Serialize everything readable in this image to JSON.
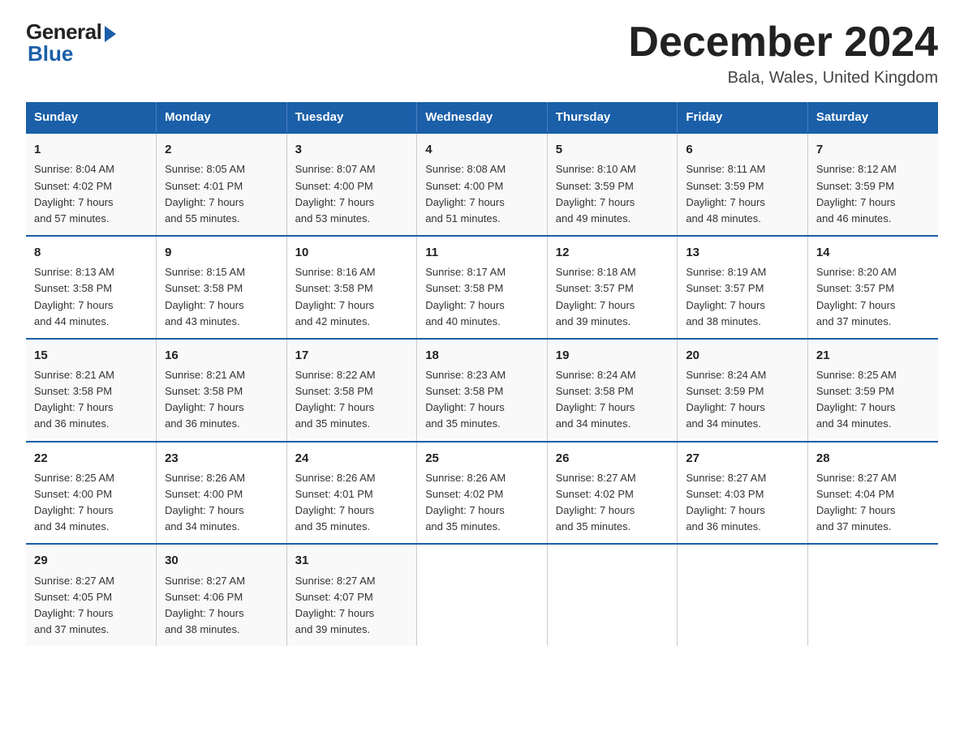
{
  "logo": {
    "general": "General",
    "blue": "Blue"
  },
  "header": {
    "month_year": "December 2024",
    "location": "Bala, Wales, United Kingdom"
  },
  "weekdays": [
    "Sunday",
    "Monday",
    "Tuesday",
    "Wednesday",
    "Thursday",
    "Friday",
    "Saturday"
  ],
  "weeks": [
    [
      {
        "day": "1",
        "sunrise": "8:04 AM",
        "sunset": "4:02 PM",
        "daylight": "7 hours and 57 minutes."
      },
      {
        "day": "2",
        "sunrise": "8:05 AM",
        "sunset": "4:01 PM",
        "daylight": "7 hours and 55 minutes."
      },
      {
        "day": "3",
        "sunrise": "8:07 AM",
        "sunset": "4:00 PM",
        "daylight": "7 hours and 53 minutes."
      },
      {
        "day": "4",
        "sunrise": "8:08 AM",
        "sunset": "4:00 PM",
        "daylight": "7 hours and 51 minutes."
      },
      {
        "day": "5",
        "sunrise": "8:10 AM",
        "sunset": "3:59 PM",
        "daylight": "7 hours and 49 minutes."
      },
      {
        "day": "6",
        "sunrise": "8:11 AM",
        "sunset": "3:59 PM",
        "daylight": "7 hours and 48 minutes."
      },
      {
        "day": "7",
        "sunrise": "8:12 AM",
        "sunset": "3:59 PM",
        "daylight": "7 hours and 46 minutes."
      }
    ],
    [
      {
        "day": "8",
        "sunrise": "8:13 AM",
        "sunset": "3:58 PM",
        "daylight": "7 hours and 44 minutes."
      },
      {
        "day": "9",
        "sunrise": "8:15 AM",
        "sunset": "3:58 PM",
        "daylight": "7 hours and 43 minutes."
      },
      {
        "day": "10",
        "sunrise": "8:16 AM",
        "sunset": "3:58 PM",
        "daylight": "7 hours and 42 minutes."
      },
      {
        "day": "11",
        "sunrise": "8:17 AM",
        "sunset": "3:58 PM",
        "daylight": "7 hours and 40 minutes."
      },
      {
        "day": "12",
        "sunrise": "8:18 AM",
        "sunset": "3:57 PM",
        "daylight": "7 hours and 39 minutes."
      },
      {
        "day": "13",
        "sunrise": "8:19 AM",
        "sunset": "3:57 PM",
        "daylight": "7 hours and 38 minutes."
      },
      {
        "day": "14",
        "sunrise": "8:20 AM",
        "sunset": "3:57 PM",
        "daylight": "7 hours and 37 minutes."
      }
    ],
    [
      {
        "day": "15",
        "sunrise": "8:21 AM",
        "sunset": "3:58 PM",
        "daylight": "7 hours and 36 minutes."
      },
      {
        "day": "16",
        "sunrise": "8:21 AM",
        "sunset": "3:58 PM",
        "daylight": "7 hours and 36 minutes."
      },
      {
        "day": "17",
        "sunrise": "8:22 AM",
        "sunset": "3:58 PM",
        "daylight": "7 hours and 35 minutes."
      },
      {
        "day": "18",
        "sunrise": "8:23 AM",
        "sunset": "3:58 PM",
        "daylight": "7 hours and 35 minutes."
      },
      {
        "day": "19",
        "sunrise": "8:24 AM",
        "sunset": "3:58 PM",
        "daylight": "7 hours and 34 minutes."
      },
      {
        "day": "20",
        "sunrise": "8:24 AM",
        "sunset": "3:59 PM",
        "daylight": "7 hours and 34 minutes."
      },
      {
        "day": "21",
        "sunrise": "8:25 AM",
        "sunset": "3:59 PM",
        "daylight": "7 hours and 34 minutes."
      }
    ],
    [
      {
        "day": "22",
        "sunrise": "8:25 AM",
        "sunset": "4:00 PM",
        "daylight": "7 hours and 34 minutes."
      },
      {
        "day": "23",
        "sunrise": "8:26 AM",
        "sunset": "4:00 PM",
        "daylight": "7 hours and 34 minutes."
      },
      {
        "day": "24",
        "sunrise": "8:26 AM",
        "sunset": "4:01 PM",
        "daylight": "7 hours and 35 minutes."
      },
      {
        "day": "25",
        "sunrise": "8:26 AM",
        "sunset": "4:02 PM",
        "daylight": "7 hours and 35 minutes."
      },
      {
        "day": "26",
        "sunrise": "8:27 AM",
        "sunset": "4:02 PM",
        "daylight": "7 hours and 35 minutes."
      },
      {
        "day": "27",
        "sunrise": "8:27 AM",
        "sunset": "4:03 PM",
        "daylight": "7 hours and 36 minutes."
      },
      {
        "day": "28",
        "sunrise": "8:27 AM",
        "sunset": "4:04 PM",
        "daylight": "7 hours and 37 minutes."
      }
    ],
    [
      {
        "day": "29",
        "sunrise": "8:27 AM",
        "sunset": "4:05 PM",
        "daylight": "7 hours and 37 minutes."
      },
      {
        "day": "30",
        "sunrise": "8:27 AM",
        "sunset": "4:06 PM",
        "daylight": "7 hours and 38 minutes."
      },
      {
        "day": "31",
        "sunrise": "8:27 AM",
        "sunset": "4:07 PM",
        "daylight": "7 hours and 39 minutes."
      },
      null,
      null,
      null,
      null
    ]
  ],
  "labels": {
    "sunrise": "Sunrise:",
    "sunset": "Sunset:",
    "daylight": "Daylight:"
  }
}
